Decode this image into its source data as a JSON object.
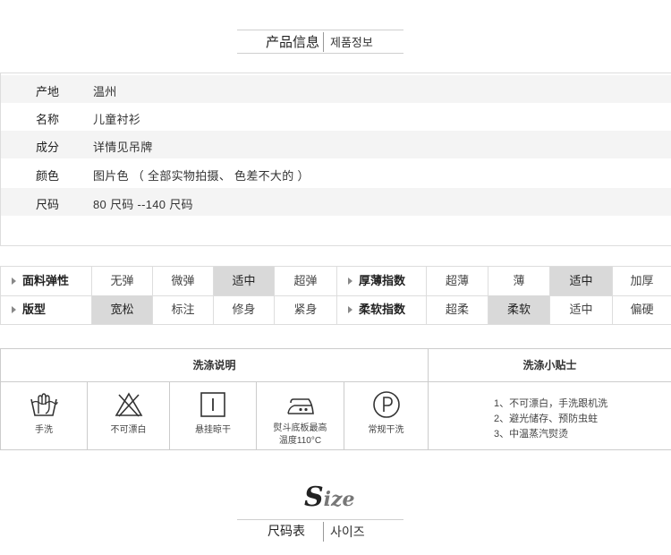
{
  "product_header": {
    "cn": "产品信息",
    "kr": "제품정보"
  },
  "info_rows": [
    {
      "key": "产地",
      "value": "温州"
    },
    {
      "key": "名称",
      "value": "儿童衬衫"
    },
    {
      "key": "成分",
      "value": "详情见吊牌"
    },
    {
      "key": "颜色",
      "value": "图片色  （ 全部实物拍摄、  色差不大的 ）"
    },
    {
      "key": "尺码",
      "value": "80 尺码 --140 尺码"
    }
  ],
  "attributes": [
    {
      "label": "面料弹性",
      "options": [
        "无弹",
        "微弹",
        "适中",
        "超弹"
      ],
      "selected": "适中"
    },
    {
      "label": "厚薄指数",
      "options": [
        "超薄",
        "薄",
        "适中",
        "加厚"
      ],
      "selected": "适中"
    },
    {
      "label": "版型",
      "options": [
        "宽松",
        "标注",
        "修身",
        "紧身"
      ],
      "selected": "宽松"
    },
    {
      "label": "柔软指数",
      "options": [
        "超柔",
        "柔软",
        "适中",
        "偏硬"
      ],
      "selected": "柔软"
    }
  ],
  "wash": {
    "title": "洗涤说明",
    "tips_title": "洗涤小贴士",
    "icons": [
      {
        "icon": "hand-wash-icon",
        "label": "手洗"
      },
      {
        "icon": "no-bleach-icon",
        "label": "不可漂白"
      },
      {
        "icon": "hang-dry-icon",
        "label": "悬挂晾干"
      },
      {
        "icon": "iron-icon",
        "label_1": "熨斗底板最高",
        "label_2": "温度110°C"
      },
      {
        "icon": "dry-clean-icon",
        "label": "常规干洗"
      }
    ],
    "tips": [
      "1、不可漂白，手洗跟机洗",
      "2、避光储存、预防虫蛀",
      "3、中温蒸汽熨烫"
    ]
  },
  "size_header": {
    "big": "S",
    "rest": "ize",
    "cn": "尺码表",
    "kr": "사이즈"
  }
}
